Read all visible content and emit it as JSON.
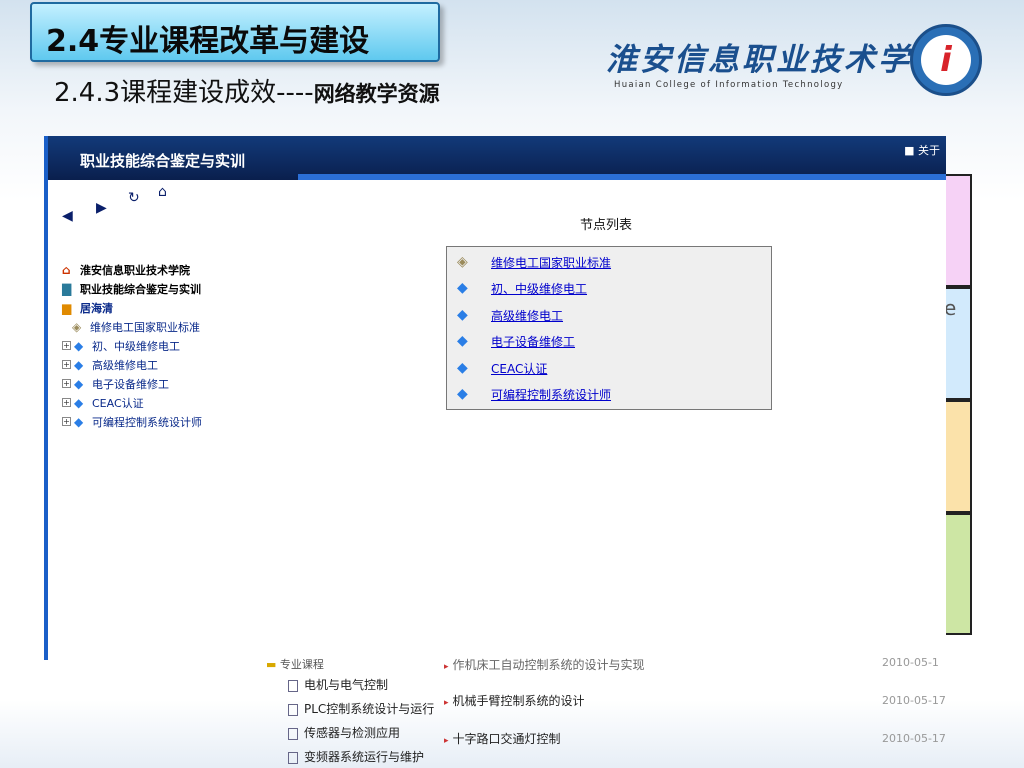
{
  "slide": {
    "title": "2.4专业课程改革与建设",
    "subtitle_prefix": "2.4.3课程建设成效----",
    "subtitle_bold": "网络教学资源",
    "college_name": "淮安信息职业技术学院",
    "college_name_en": "Huaian College of Information Technology",
    "logo_glyph": "i"
  },
  "bars": {
    "partial_text": "e",
    "colors": [
      "#f6d2f6",
      "#d2eafc",
      "#fbe2aa",
      "#cde6a4"
    ]
  },
  "app": {
    "header_title": "职业技能综合鉴定与实训",
    "about_link": "■ 关于",
    "nav_icons": [
      "back-arrow-icon",
      "forward-arrow-icon",
      "refresh-icon",
      "home-icon"
    ],
    "tree": [
      {
        "label": "淮安信息职业技术学院",
        "icon": "house-icon",
        "bold": true
      },
      {
        "label": "职业技能综合鉴定与实训",
        "icon": "book-icon",
        "bold": true
      },
      {
        "label": "居海清",
        "icon": "gift-icon",
        "bold": true
      },
      {
        "label": "维修电工国家职业标准",
        "icon": "leaf-icon",
        "bold": false,
        "expandable": false
      },
      {
        "label": "初、中级维修电工",
        "icon": "diamond-icon",
        "bold": false,
        "expandable": true
      },
      {
        "label": "高级维修电工",
        "icon": "diamond-icon",
        "bold": false,
        "expandable": true
      },
      {
        "label": "电子设备维修工",
        "icon": "diamond-icon",
        "bold": false,
        "expandable": true
      },
      {
        "label": "CEAC认证",
        "icon": "diamond-icon",
        "bold": false,
        "expandable": true
      },
      {
        "label": "可编程控制系统设计师",
        "icon": "diamond-icon",
        "bold": false,
        "expandable": true
      }
    ],
    "node_list_title": "节点列表",
    "node_list": [
      {
        "label": "维修电工国家职业标准",
        "icon": "leaf-icon"
      },
      {
        "label": "初、中级维修电工",
        "icon": "diamond-icon"
      },
      {
        "label": "高级维修电工",
        "icon": "diamond-icon"
      },
      {
        "label": "电子设备维修工",
        "icon": "diamond-icon"
      },
      {
        "label": "CEAC认证",
        "icon": "diamond-icon"
      },
      {
        "label": "可编程控制系统设计师",
        "icon": "diamond-icon"
      }
    ]
  },
  "bottom_shot": {
    "tree_partial": "专业课程",
    "tree_items": [
      "电机与电气控制",
      "PLC控制系统设计与运行",
      "传感器与检测应用",
      "变频器系统运行与维护"
    ],
    "list_items": [
      {
        "title": "作机床工自动控制系统的设计与实现",
        "date": "2010-05-1"
      },
      {
        "title": "机械手臂控制系统的设计",
        "date": "2010-05-17"
      },
      {
        "title": "十字路口交通灯控制",
        "date": "2010-05-17"
      }
    ]
  }
}
